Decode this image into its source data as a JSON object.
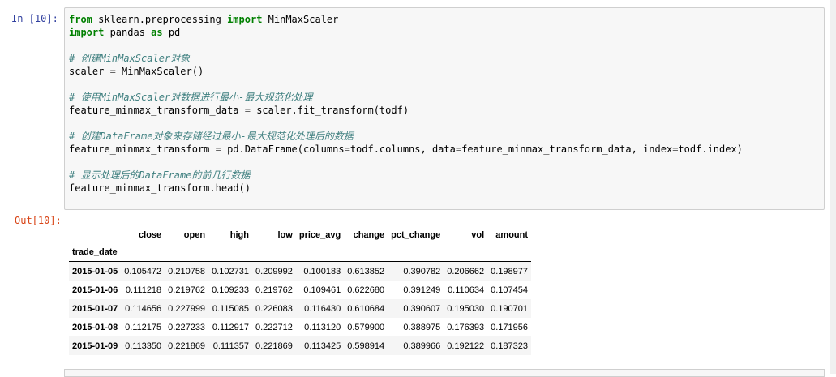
{
  "input_cell": {
    "prompt": "In  [10]:",
    "code": {
      "line1": {
        "kw1": "from",
        "t1": " sklearn.preprocessing ",
        "kw2": "import",
        "t2": " MinMaxScaler"
      },
      "line2": {
        "kw1": "import",
        "t1": " pandas ",
        "kw2": "as",
        "t2": " pd"
      },
      "line4": "# 创建MinMaxScaler对象",
      "line5": {
        "a": "scaler ",
        "op": "=",
        "b": " MinMaxScaler()"
      },
      "line7": "# 使用MinMaxScaler对数据进行最小-最大规范化处理",
      "line8": {
        "a": "feature_minmax_transform_data ",
        "op": "=",
        "b": " scaler.fit_transform(todf)"
      },
      "line10": "# 创建DataFrame对象来存储经过最小-最大规范化处理后的数据",
      "line11": {
        "a": "feature_minmax_transform ",
        "op": "=",
        "b": " pd.DataFrame(columns",
        "op2": "=",
        "c": "todf.columns, data",
        "op3": "=",
        "d": "feature_minmax_transform_data, index",
        "op4": "=",
        "e": "todf.index)"
      },
      "line13": "# 显示处理后的DataFrame的前几行数据",
      "line14": "feature_minmax_transform.head()"
    }
  },
  "output_cell": {
    "prompt": "Out[10]:",
    "table": {
      "columns": [
        "close",
        "open",
        "high",
        "low",
        "price_avg",
        "change",
        "pct_change",
        "vol",
        "amount"
      ],
      "index_name": "trade_date",
      "rows": [
        {
          "index": "2015-01-05",
          "values": [
            "0.105472",
            "0.210758",
            "0.102731",
            "0.209992",
            "0.100183",
            "0.613852",
            "0.390782",
            "0.206662",
            "0.198977"
          ]
        },
        {
          "index": "2015-01-06",
          "values": [
            "0.111218",
            "0.219762",
            "0.109233",
            "0.219762",
            "0.109461",
            "0.622680",
            "0.391249",
            "0.110634",
            "0.107454"
          ]
        },
        {
          "index": "2015-01-07",
          "values": [
            "0.114656",
            "0.227999",
            "0.115085",
            "0.226083",
            "0.116430",
            "0.610684",
            "0.390607",
            "0.195030",
            "0.190701"
          ]
        },
        {
          "index": "2015-01-08",
          "values": [
            "0.112175",
            "0.227233",
            "0.112917",
            "0.222712",
            "0.113120",
            "0.579900",
            "0.388975",
            "0.176393",
            "0.171956"
          ]
        },
        {
          "index": "2015-01-09",
          "values": [
            "0.113350",
            "0.221869",
            "0.111357",
            "0.221869",
            "0.113425",
            "0.598914",
            "0.389966",
            "0.192122",
            "0.187323"
          ]
        }
      ]
    }
  },
  "colors": {
    "prompt_in": "#303F9F",
    "prompt_out": "#D84315",
    "keyword": "#008000",
    "comment": "#408080"
  }
}
